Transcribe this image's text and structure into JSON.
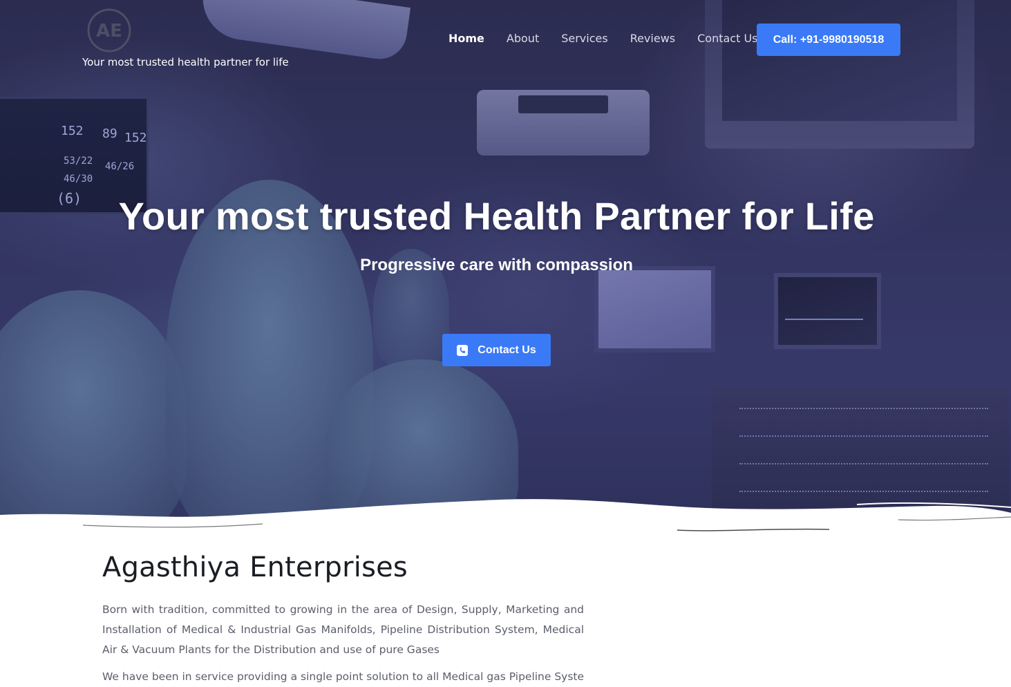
{
  "brand": {
    "logo_text": "AE",
    "tagline": "Your most trusted health partner for life"
  },
  "nav": {
    "items": [
      {
        "label": "Home",
        "active": true
      },
      {
        "label": "About",
        "active": false
      },
      {
        "label": "Services",
        "active": false
      },
      {
        "label": "Reviews",
        "active": false
      },
      {
        "label": "Contact Us",
        "active": false
      }
    ],
    "call_button": "Call: +91-9980190518"
  },
  "hero": {
    "title": "Your most trusted Health Partner for Life",
    "subtitle": "Progressive care with compassion",
    "button_label": "Contact Us",
    "button_icon": "phone-square-icon"
  },
  "hero_scene": {
    "vitals": [
      "152",
      "89",
      "152",
      "53/22",
      "46/26",
      "46/30",
      "(6)"
    ]
  },
  "about": {
    "title": "Agasthiya Enterprises",
    "paragraph": "Born with tradition, committed to growing in the area of Design, Supply, Marketing and Installation of Medical & Industrial Gas Manifolds, Pipeline Distribution System, Medical Air & Vacuum Plants for the Distribution and use of pure Gases",
    "paragraph2": "We have been in service providing a single point solution to all Medical gas Pipeline Systems"
  },
  "colors": {
    "accent": "#3a7af7",
    "heading": "#1b1d24",
    "body_text": "#5b5e6a",
    "hero_overlay": "#2d2d6e"
  }
}
